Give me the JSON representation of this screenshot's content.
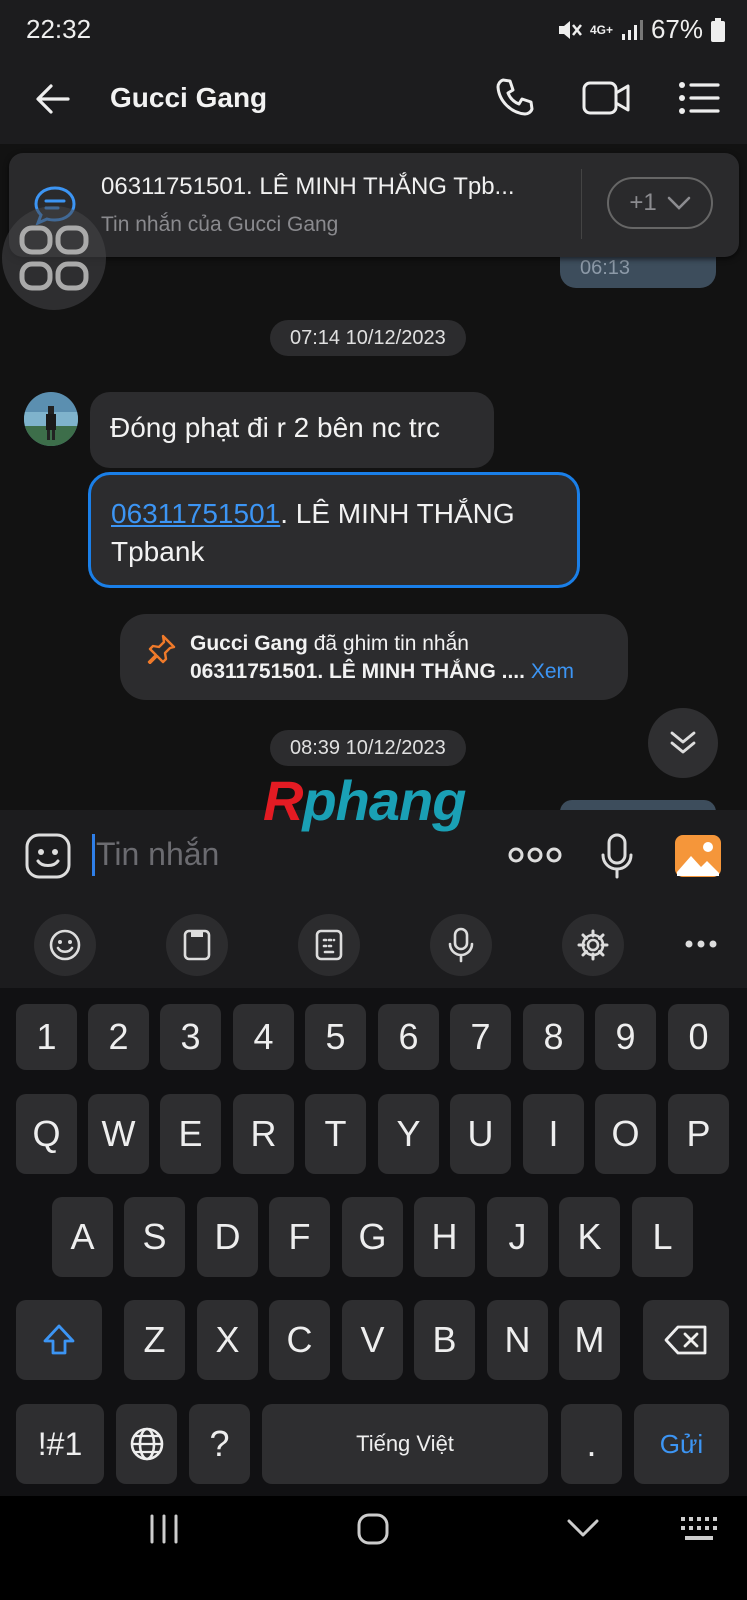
{
  "status_bar": {
    "time": "22:32",
    "network": "4G+",
    "battery": "67%"
  },
  "header": {
    "title": "Gucci Gang"
  },
  "pinned_banner": {
    "text": "06311751501. LÊ MINH THẮNG Tpb...",
    "subtitle": "Tin nhắn của Gucci Gang",
    "more_label": "+1"
  },
  "chat": {
    "partial_time": "06:13",
    "timestamp_1": "07:14 10/12/2023",
    "message_1": "Đóng phạt đi r 2 bên nc trc",
    "message_2": {
      "link": "06311751501",
      "rest": ". LÊ MINH THẮNG Tpbank"
    },
    "system_message": {
      "actor": "Gucci Gang",
      "action": " đã ghim tin nhắn",
      "preview": "06311751501. LÊ MINH THẮNG ....",
      "view_label": " Xem"
    },
    "timestamp_2": "08:39 10/12/2023"
  },
  "watermark": {
    "part1": "R",
    "part2": "phang"
  },
  "composer": {
    "placeholder": "Tin nhắn"
  },
  "keyboard": {
    "row_numbers": [
      "1",
      "2",
      "3",
      "4",
      "5",
      "6",
      "7",
      "8",
      "9",
      "0"
    ],
    "row_1": [
      "Q",
      "W",
      "E",
      "R",
      "T",
      "Y",
      "U",
      "I",
      "O",
      "P"
    ],
    "row_2": [
      "A",
      "S",
      "D",
      "F",
      "G",
      "H",
      "J",
      "K",
      "L"
    ],
    "row_3": [
      "Z",
      "X",
      "C",
      "V",
      "B",
      "N",
      "M"
    ],
    "symbols_label": "!#1",
    "question_label": "?",
    "space_label": "Tiếng Việt",
    "period_label": ".",
    "send_label": "Gửi"
  },
  "colors": {
    "accent_blue": "#3c95f4",
    "pin_orange": "#f07a2a",
    "gallery_orange": "#f5963a"
  }
}
